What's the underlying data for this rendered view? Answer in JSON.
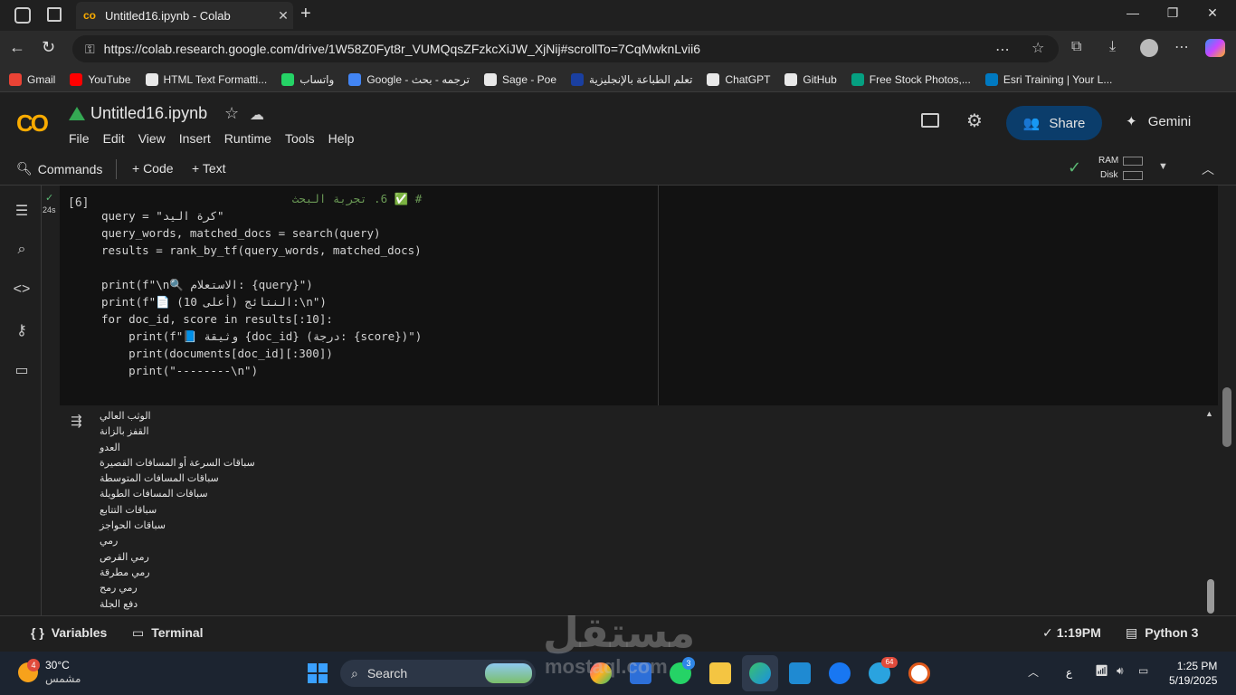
{
  "browser": {
    "tab_title": "Untitled16.ipynb - Colab",
    "url": "https://colab.research.google.com/drive/1W58Z0Fyt8r_VUMQqsZFzkcXiJW_XjNij#scrollTo=7CqMwknLvii6",
    "bookmarks": [
      {
        "label": "Gmail",
        "color": "#ea4335"
      },
      {
        "label": "YouTube",
        "color": "#ff0000"
      },
      {
        "label": "HTML Text Formatti...",
        "color": "#e8e8e8"
      },
      {
        "label": "واتساب",
        "color": "#25d366"
      },
      {
        "label": "Google - ترجمه - بحث",
        "color": "#4285f4"
      },
      {
        "label": "Sage - Poe",
        "color": "#e8e8e8"
      },
      {
        "label": "تعلم الطباعة بالإنجليزية",
        "color": "#1a3fa0"
      },
      {
        "label": "ChatGPT",
        "color": "#e8e8e8"
      },
      {
        "label": "GitHub",
        "color": "#e8e8e8"
      },
      {
        "label": "Free Stock Photos,...",
        "color": "#05a081"
      },
      {
        "label": "Esri Training | Your L...",
        "color": "#0079c1"
      }
    ]
  },
  "colab": {
    "logo": "CO",
    "notebook_title": "Untitled16.ipynb",
    "menu": [
      "File",
      "Edit",
      "View",
      "Insert",
      "Runtime",
      "Tools",
      "Help"
    ],
    "share_label": "Share",
    "gemini_label": "Gemini",
    "toolbar": {
      "commands": "Commands",
      "code": "+ Code",
      "text": "+ Text",
      "ram": "RAM",
      "disk": "Disk"
    },
    "cell": {
      "exec_count": "[6]",
      "run_time": "24s",
      "code_lines": [
        "# ✅ 6. تجربة البحث",
        "query = \"كرة اليد\"",
        "query_words, matched_docs = search(query)",
        "results = rank_by_tf(query_words, matched_docs)",
        "",
        "print(f\"\\n🔍 الاستعلام: {query}\")",
        "print(f\"📄 النتائج (أعلى 10):\\n\")",
        "for doc_id, score in results[:10]:",
        "    print(f\"📘 وثيقة {doc_id} (درجة: {score})\")",
        "    print(documents[doc_id][:300])",
        "    print(\"--------\\n\")"
      ]
    },
    "output_lines": [
      "الوثب العالي",
      "القفز بالزانة",
      "العدو",
      "سباقات السرعة أو المسافات القصيرة",
      "سباقات المسافات المتوسطة",
      "سباقات المسافات الطويلة",
      "سباقات التتابع",
      "سباقات الحواجز",
      "رمي",
      "رمي القرص",
      "رمي مطرقة",
      "رمي رمح",
      "دفع الجلة"
    ],
    "status": {
      "variables": "Variables",
      "terminal": "Terminal",
      "time": "1:19PM",
      "runtime": "Python 3"
    }
  },
  "taskbar": {
    "weather_temp": "30°C",
    "weather_desc": "مشمس",
    "weather_badge": "4",
    "search_label": "Search",
    "lang": "ع",
    "clock_time": "1:25 PM",
    "clock_date": "5/19/2025",
    "whatsapp_badge": "3",
    "telegram_badge": "64"
  },
  "watermark": {
    "main": "مستقل",
    "sub": "mostaql.com"
  }
}
